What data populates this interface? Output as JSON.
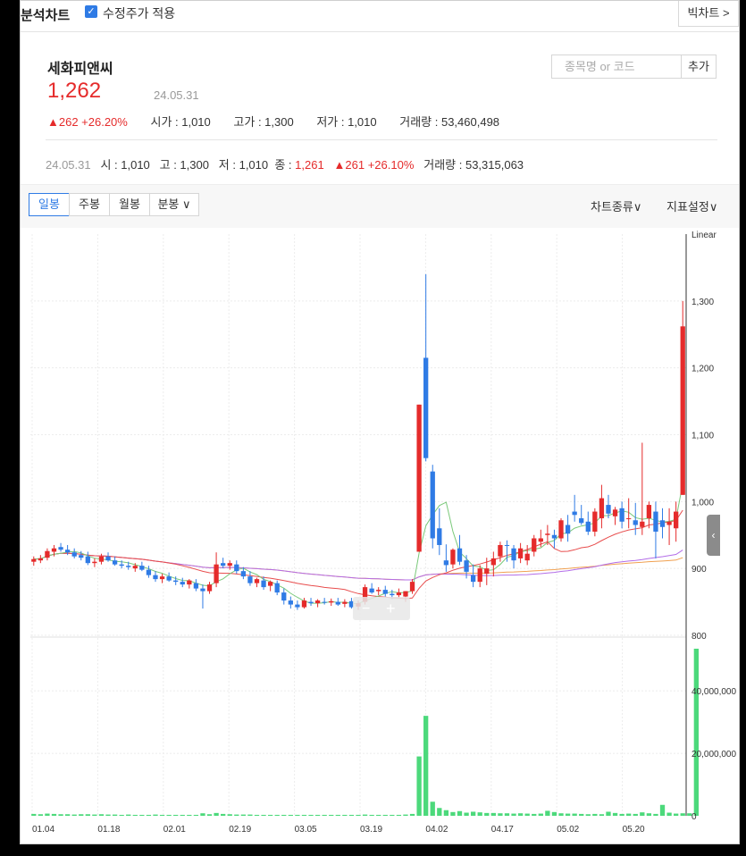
{
  "header": {
    "title": "분석차트",
    "adjusted_price_label": "수정주가 적용",
    "big_chart_label": "빅차트 >"
  },
  "stock": {
    "name": "세화피앤씨",
    "price": "1,262",
    "date": "24.05.31",
    "change": "▲262 +26.20%",
    "open": "시가 : 1,010",
    "high": "고가 : 1,300",
    "low": "저가 : 1,010",
    "volume": "거래량 : 53,460,498"
  },
  "search": {
    "placeholder": "종목명 or 코드",
    "add_label": "추가"
  },
  "ohlc_row": {
    "date": "24.05.31",
    "open": "시 : 1,010",
    "high": "고 : 1,300",
    "low": "저 : 1,010",
    "close_label": "종 : ",
    "close": "1,261",
    "change": "▲261 +26.10%",
    "volume": "거래량 : 53,315,063"
  },
  "tabs": [
    {
      "label": "일봉",
      "active": true
    },
    {
      "label": "주봉",
      "active": false
    },
    {
      "label": "월봉",
      "active": false
    },
    {
      "label": "분봉 ∨",
      "active": false
    }
  ],
  "chart_type_label": "차트종류∨",
  "indicator_label": "지표설정∨",
  "colors": {
    "up": "#e52b2b",
    "down": "#2f7be5",
    "volume": "#4cd97b",
    "ma5": "#7ac97a",
    "ma20": "#e84d4d",
    "ma60": "#b36de8",
    "ma120": "#f0a050"
  },
  "chart_data": {
    "type": "candlestick",
    "scale_label": "Linear",
    "x_ticks": [
      "01.04",
      "01.18",
      "02.01",
      "02.19",
      "03.05",
      "03.19",
      "04.02",
      "04.17",
      "05.02",
      "05.20"
    ],
    "price_ylim": [
      800,
      1400
    ],
    "price_ticks": [
      "1,300",
      "1,200",
      "1,100",
      "1,000",
      "900",
      "800"
    ],
    "volume_ticks": [
      "40,000,000",
      "20,000,000",
      "0"
    ],
    "candles": [
      [
        910,
        918,
        904,
        914
      ],
      [
        912,
        920,
        908,
        915
      ],
      [
        916,
        930,
        912,
        926
      ],
      [
        925,
        935,
        918,
        930
      ],
      [
        932,
        938,
        925,
        928
      ],
      [
        928,
        935,
        920,
        924
      ],
      [
        924,
        930,
        915,
        918
      ],
      [
        920,
        926,
        912,
        916
      ],
      [
        918,
        925,
        905,
        908
      ],
      [
        908,
        915,
        902,
        910
      ],
      [
        910,
        922,
        906,
        918
      ],
      [
        918,
        924,
        910,
        912
      ],
      [
        912,
        918,
        904,
        906
      ],
      [
        906,
        912,
        900,
        904
      ],
      [
        904,
        910,
        898,
        902
      ],
      [
        900,
        908,
        895,
        904
      ],
      [
        904,
        910,
        896,
        898
      ],
      [
        898,
        904,
        886,
        890
      ],
      [
        890,
        896,
        880,
        884
      ],
      [
        884,
        892,
        878,
        888
      ],
      [
        888,
        894,
        880,
        882
      ],
      [
        882,
        888,
        875,
        880
      ],
      [
        880,
        886,
        872,
        876
      ],
      [
        876,
        884,
        870,
        882
      ],
      [
        878,
        884,
        866,
        870
      ],
      [
        870,
        876,
        840,
        866
      ],
      [
        866,
        880,
        862,
        876
      ],
      [
        878,
        924,
        872,
        906
      ],
      [
        908,
        916,
        900,
        904
      ],
      [
        904,
        912,
        898,
        908
      ],
      [
        906,
        912,
        892,
        896
      ],
      [
        896,
        902,
        884,
        888
      ],
      [
        888,
        896,
        874,
        878
      ],
      [
        878,
        886,
        872,
        884
      ],
      [
        882,
        888,
        868,
        872
      ],
      [
        874,
        882,
        866,
        880
      ],
      [
        878,
        882,
        860,
        864
      ],
      [
        864,
        870,
        846,
        852
      ],
      [
        852,
        858,
        840,
        846
      ],
      [
        846,
        852,
        838,
        842
      ],
      [
        842,
        856,
        840,
        852
      ],
      [
        850,
        856,
        844,
        848
      ],
      [
        848,
        854,
        842,
        852
      ],
      [
        850,
        856,
        846,
        849
      ],
      [
        849,
        855,
        844,
        851
      ],
      [
        850,
        856,
        844,
        846
      ],
      [
        847,
        854,
        842,
        850
      ],
      [
        851,
        856,
        840,
        842
      ],
      [
        843,
        852,
        838,
        848
      ],
      [
        850,
        876,
        846,
        872
      ],
      [
        870,
        878,
        862,
        864
      ],
      [
        866,
        872,
        860,
        868
      ],
      [
        868,
        874,
        858,
        862
      ],
      [
        862,
        868,
        854,
        860
      ],
      [
        860,
        870,
        856,
        864
      ],
      [
        858,
        866,
        850,
        866
      ],
      [
        866,
        884,
        862,
        880
      ],
      [
        925,
        1145,
        925,
        1145
      ],
      [
        1215,
        1340,
        1060,
        1065
      ],
      [
        1045,
        1055,
        930,
        945
      ],
      [
        960,
        990,
        920,
        935
      ],
      [
        912,
        936,
        895,
        905
      ],
      [
        906,
        930,
        900,
        928
      ],
      [
        930,
        950,
        905,
        910
      ],
      [
        912,
        920,
        885,
        895
      ],
      [
        890,
        906,
        872,
        880
      ],
      [
        880,
        905,
        872,
        900
      ],
      [
        892,
        916,
        875,
        900
      ],
      [
        905,
        925,
        888,
        915
      ],
      [
        918,
        940,
        910,
        935
      ],
      [
        935,
        942,
        910,
        934
      ],
      [
        930,
        935,
        900,
        912
      ],
      [
        915,
        938,
        908,
        930
      ],
      [
        912,
        935,
        905,
        922
      ],
      [
        925,
        950,
        918,
        945
      ],
      [
        940,
        958,
        932,
        945
      ],
      [
        950,
        965,
        935,
        952
      ],
      [
        950,
        958,
        930,
        945
      ],
      [
        945,
        975,
        940,
        972
      ],
      [
        965,
        980,
        940,
        952
      ],
      [
        985,
        1010,
        970,
        980
      ],
      [
        975,
        995,
        965,
        968
      ],
      [
        970,
        985,
        950,
        955
      ],
      [
        955,
        990,
        948,
        985
      ],
      [
        975,
        1025,
        960,
        1005
      ],
      [
        995,
        1010,
        975,
        982
      ],
      [
        978,
        992,
        965,
        988
      ],
      [
        990,
        1000,
        960,
        970
      ],
      [
        975,
        1005,
        960,
        975
      ],
      [
        972,
        998,
        950,
        965
      ],
      [
        962,
        1088,
        950,
        970
      ],
      [
        975,
        1000,
        960,
        995
      ],
      [
        985,
        1000,
        915,
        955
      ],
      [
        972,
        990,
        945,
        962
      ],
      [
        965,
        990,
        935,
        970
      ],
      [
        960,
        1000,
        940,
        985
      ],
      [
        1010,
        1300,
        1010,
        1262
      ]
    ],
    "volume_millions": [
      0.6,
      0.5,
      0.7,
      0.6,
      0.5,
      0.5,
      0.4,
      0.5,
      0.5,
      0.4,
      0.5,
      0.4,
      0.4,
      0.3,
      0.4,
      0.3,
      0.3,
      0.3,
      0.4,
      0.3,
      0.3,
      0.3,
      0.3,
      0.3,
      0.3,
      0.8,
      0.5,
      0.9,
      0.6,
      0.5,
      0.4,
      0.4,
      0.4,
      0.3,
      0.3,
      0.3,
      0.3,
      0.3,
      0.3,
      0.3,
      0.3,
      0.3,
      0.3,
      0.3,
      0.3,
      0.3,
      0.3,
      0.3,
      0.3,
      0.4,
      0.3,
      0.3,
      0.3,
      0.3,
      0.3,
      0.4,
      0.6,
      19.0,
      32.0,
      4.5,
      2.5,
      1.8,
      1.2,
      1.5,
      1.0,
      1.3,
      1.1,
      0.9,
      0.9,
      0.8,
      0.8,
      0.7,
      0.8,
      0.7,
      0.6,
      0.7,
      1.6,
      1.2,
      0.8,
      0.7,
      0.7,
      0.6,
      0.5,
      0.6,
      0.5,
      1.3,
      0.9,
      0.6,
      0.7,
      0.6,
      1.1,
      0.8,
      0.6,
      3.5,
      1.0,
      0.7,
      0.8,
      0.8,
      53.5
    ]
  }
}
